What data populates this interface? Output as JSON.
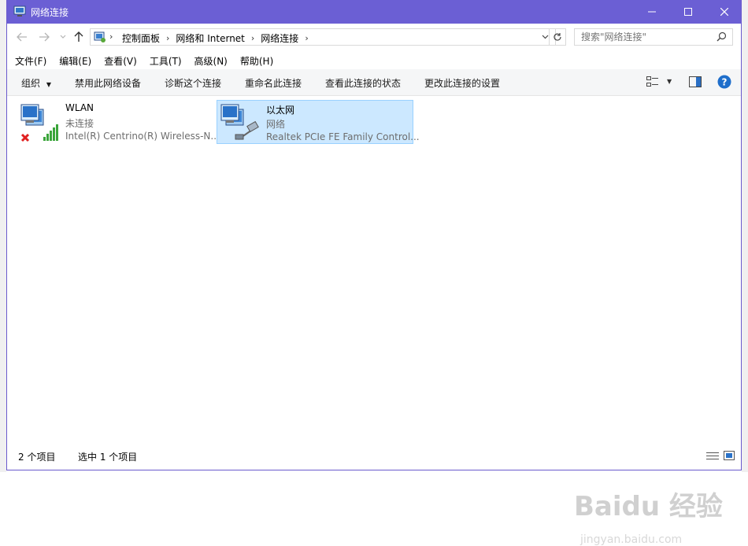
{
  "window": {
    "title": "网络连接"
  },
  "address": {
    "crumbs": [
      "控制面板",
      "网络和 Internet",
      "网络连接"
    ]
  },
  "search": {
    "placeholder": "搜索\"网络连接\""
  },
  "menu": [
    "文件(F)",
    "编辑(E)",
    "查看(V)",
    "工具(T)",
    "高级(N)",
    "帮助(H)"
  ],
  "commands": {
    "organize": "组织",
    "disable": "禁用此网络设备",
    "diagnose": "诊断这个连接",
    "rename": "重命名此连接",
    "status": "查看此连接的状态",
    "settings": "更改此连接的设置"
  },
  "connections": [
    {
      "name": "WLAN",
      "status": "未连接",
      "device": "Intel(R) Centrino(R) Wireless-N...",
      "icon": "wireless-network-disconnected-icon"
    },
    {
      "name": "以太网",
      "status": "网络",
      "device": "Realtek PCIe FE Family Control...",
      "icon": "ethernet-network-icon"
    }
  ],
  "statusbar": {
    "count": "2 个项目",
    "selected": "选中 1 个项目"
  },
  "watermark": {
    "brand": "Baidu 经验",
    "url": "jingyan.baidu.com"
  },
  "colors": {
    "titlebar": "#6b5fd4",
    "selection": "#cce8ff",
    "help": "#1e6ecb"
  }
}
